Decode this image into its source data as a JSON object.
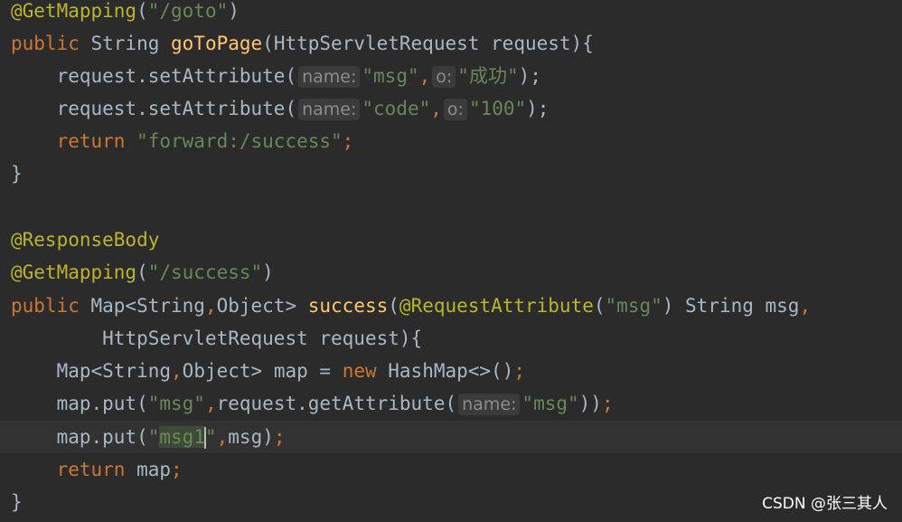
{
  "editor": {
    "lines": {
      "l1": {
        "a": "@GetMapping",
        "b": "(",
        "c": "\"/goto\"",
        "d": ")"
      },
      "l2": {
        "kw": "public",
        "t1": " String ",
        "fn": "goToPage",
        "t2": "(HttpServletRequest request){"
      },
      "l3": {
        "t1": "request.setAttribute(",
        "h1": "name:",
        "s1": "\"msg\"",
        "p1": ",",
        "h2": "o:",
        "s2": "\"成功\"",
        "t2": ");"
      },
      "l4": {
        "t1": "request.setAttribute(",
        "h1": "name:",
        "s1": "\"code\"",
        "p1": ",",
        "h2": "o:",
        "s2": "\"100\"",
        "t2": ");"
      },
      "l5": {
        "kw": "return",
        "s1": "\"forward:/success\"",
        "p1": ";"
      },
      "l6": {
        "t1": "}"
      },
      "l8": {
        "a": "@ResponseBody"
      },
      "l9": {
        "a": "@GetMapping",
        "b": "(",
        "c": "\"/success\"",
        "d": ")"
      },
      "l10": {
        "kw": "public",
        "t1": " Map<String",
        "p1": ",",
        "t2": "Object> ",
        "fn": "success",
        "t3": "(",
        "a": "@RequestAttribute",
        "t4": "(",
        "s1": "\"msg\"",
        "t5": ") String msg",
        "p2": ","
      },
      "l11": {
        "t1": "HttpServletRequest request){"
      },
      "l12": {
        "t1": "Map<String",
        "p1": ",",
        "t2": "Object> map = ",
        "kw": "new",
        "t3": " HashMap<>()",
        "p2": ";"
      },
      "l13": {
        "t1": "map.put(",
        "s1": "\"msg\"",
        "p1": ",",
        "t2": "request.getAttribute(",
        "h1": "name:",
        "s2": "\"msg\"",
        "t3": "))",
        "p2": ";"
      },
      "l14": {
        "t1": "map.put(",
        "q1": "\"",
        "sel": "msg1",
        "q2": "\"",
        "p1": ",",
        "t2": "msg)",
        "p2": ";"
      },
      "l15": {
        "kw": "return",
        "t1": " map",
        "p1": ";"
      },
      "l16": {
        "t1": "}"
      }
    }
  },
  "watermark": "CSDN @张三其人",
  "colors": {
    "background": "#2b2b2b",
    "annotation": "#bbb529",
    "keyword": "#cc7832",
    "string": "#6a8759",
    "function": "#ffc66d",
    "text": "#a9b7c6"
  }
}
